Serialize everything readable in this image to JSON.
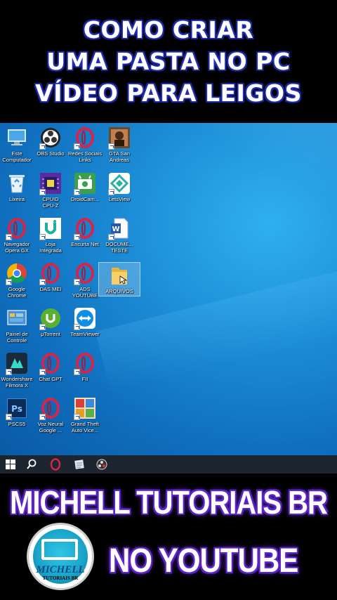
{
  "title": {
    "lines": [
      "COMO CRIAR",
      "UMA PASTA NO PC",
      "VÍDEO PARA LEIGOS"
    ]
  },
  "desktop": {
    "icons": [
      {
        "label": "Este\nComputador",
        "icon": "computer-icon"
      },
      {
        "label": "OBS Studio",
        "icon": "obs-icon"
      },
      {
        "label": "Redes Sociais\nLinks",
        "icon": "opera-icon"
      },
      {
        "label": "GTA San\nAndreas",
        "icon": "gta-icon"
      },
      {
        "label": "Lixeira",
        "icon": "recycle-bin-icon"
      },
      {
        "label": "CPUID\nCPU-Z",
        "icon": "cpuz-icon"
      },
      {
        "label": "DroidCam...",
        "icon": "droidcam-icon"
      },
      {
        "label": "LetsView",
        "icon": "letsview-icon"
      },
      {
        "label": "Navegador\nOpera GX",
        "icon": "opera-icon"
      },
      {
        "label": "Loja\nIntegrada",
        "icon": "loja-integrada-icon"
      },
      {
        "label": "Encurta Net",
        "icon": "opera-icon"
      },
      {
        "label": "DOCUME...\nTESTE",
        "icon": "word-document-icon"
      },
      {
        "label": "Google\nChrome",
        "icon": "chrome-icon"
      },
      {
        "label": "DAS MEI",
        "icon": "opera-icon"
      },
      {
        "label": "ADS\nYOUTUBE",
        "icon": "opera-icon"
      },
      {
        "label": "ARQUIVOS",
        "icon": "folder-icon"
      },
      {
        "label": "Painel de\nControle",
        "icon": "control-panel-icon"
      },
      {
        "label": "μTorrent",
        "icon": "utorrent-icon"
      },
      {
        "label": "TeamViewer",
        "icon": "teamviewer-icon"
      },
      {
        "label": "Wondershare\nFilmora X",
        "icon": "filmora-icon"
      },
      {
        "label": "Chat GPT",
        "icon": "opera-icon"
      },
      {
        "label": "FII",
        "icon": "opera-icon"
      },
      {
        "label": "PSCS5",
        "icon": "photoshop-icon"
      },
      {
        "label": "Voz Neural\nGoogle ...",
        "icon": "opera-icon"
      },
      {
        "label": "Grand Theft\nAuto Vice...",
        "icon": "gta-vice-icon"
      }
    ]
  },
  "taskbar": {
    "items": [
      "windows-start-icon",
      "search-icon",
      "opera-gx-icon",
      "notepad-icon",
      "obs-taskbar-icon"
    ]
  },
  "footer": {
    "channel_line1": "MICHELL TUTORIAIS BR",
    "channel_line2": "NO YOUTUBE",
    "logo_name": "MICHELL",
    "logo_sub": "TUTORIAIS BR"
  },
  "colors": {
    "title_outline": "#1a2697",
    "channel_outline": "#5a22c4",
    "desktop_blue": "#1d8fd8",
    "taskbar": "#1c2530",
    "opera_red": "#d3264a"
  }
}
